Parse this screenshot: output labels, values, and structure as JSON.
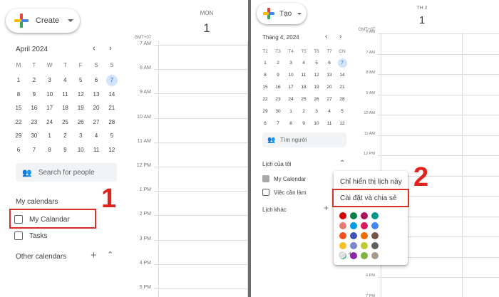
{
  "left": {
    "create_label": "Create",
    "day_name": "MON",
    "day_num": "1",
    "timezone": "GMT+07",
    "month_title": "April 2024",
    "weekday_headers": [
      "M",
      "T",
      "W",
      "T",
      "F",
      "S",
      "S"
    ],
    "weeks": [
      [
        "1",
        "2",
        "3",
        "4",
        "5",
        "6",
        "7"
      ],
      [
        "8",
        "9",
        "10",
        "11",
        "12",
        "13",
        "14"
      ],
      [
        "15",
        "16",
        "17",
        "18",
        "19",
        "20",
        "21"
      ],
      [
        "22",
        "23",
        "24",
        "25",
        "26",
        "27",
        "28"
      ],
      [
        "29",
        "30",
        "1",
        "2",
        "3",
        "4",
        "5"
      ],
      [
        "6",
        "7",
        "8",
        "9",
        "10",
        "11",
        "12"
      ]
    ],
    "search_placeholder": "Search for people",
    "my_calendars_title": "My calendars",
    "calendars": [
      "My Calandar",
      "Tasks"
    ],
    "other_calendars_title": "Other calendars",
    "hours": [
      "7 AM",
      "8 AM",
      "9 AM",
      "10 AM",
      "11 AM",
      "12 PM",
      "1 PM",
      "2 PM",
      "3 PM",
      "4 PM",
      "5 PM"
    ],
    "annotation": "1"
  },
  "right": {
    "create_label": "Tạo",
    "day_name": "TH 2",
    "day_num": "1",
    "timezone": "GMT+07",
    "month_title": "Tháng 4, 2024",
    "weekday_headers": [
      "T2",
      "T3",
      "T4",
      "T5",
      "T6",
      "T7",
      "CN"
    ],
    "weeks": [
      [
        "1",
        "2",
        "3",
        "4",
        "5",
        "6",
        "7"
      ],
      [
        "8",
        "9",
        "10",
        "11",
        "12",
        "13",
        "14"
      ],
      [
        "15",
        "16",
        "17",
        "18",
        "19",
        "20",
        "21"
      ],
      [
        "22",
        "23",
        "24",
        "25",
        "26",
        "27",
        "28"
      ],
      [
        "29",
        "30",
        "1",
        "2",
        "3",
        "4",
        "5"
      ],
      [
        "6",
        "7",
        "8",
        "9",
        "10",
        "11",
        "12"
      ]
    ],
    "search_placeholder": "Tìm người",
    "my_calendars_title": "Lịch của tôi",
    "calendars": [
      "My Calendar",
      "Việc cần làm"
    ],
    "other_calendars_title": "Lịch khác",
    "hours": [
      "6 AM",
      "7 AM",
      "8 AM",
      "9 AM",
      "10 AM",
      "11 AM",
      "12 PM",
      "1 PM",
      "2 PM",
      "3 PM",
      "4 PM",
      "5 PM",
      "6 PM",
      "7 PM"
    ],
    "menu_items": [
      "Chỉ hiển thị lịch này",
      "Cài đặt và chia sẻ"
    ],
    "annotation": "2"
  },
  "colors": {
    "accent_today": "#d2e3fc",
    "annotation_red": "#d93025",
    "palette": [
      "#d50000",
      "#e67c73",
      "#f4511e",
      "#f6bf26",
      "#33b679",
      "#0b8043",
      "#039be5",
      "#3f51b5",
      "#7986cb",
      "#8e24aa",
      "#ad1457",
      "#d81b60",
      "#ef6c00",
      "#c0ca33",
      "#7cb342",
      "#009688",
      "#4285f4",
      "#795548",
      "#616161",
      "#a79b8e"
    ]
  }
}
